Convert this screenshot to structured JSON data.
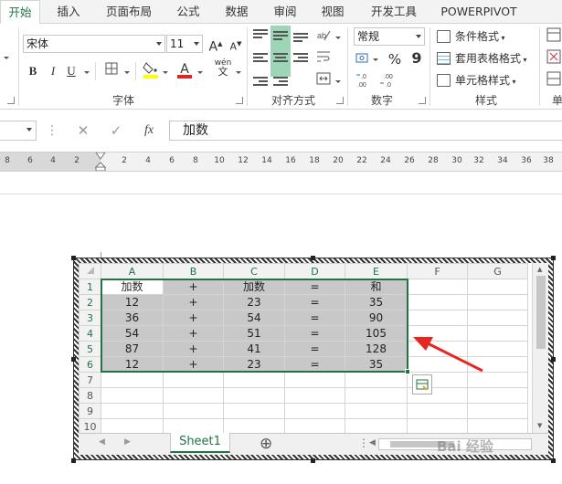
{
  "ribbon_tabs": [
    "开始",
    "插入",
    "页面布局",
    "公式",
    "数据",
    "审阅",
    "视图",
    "开发工具",
    "POWERPIVOT"
  ],
  "font_group": {
    "font_name": "宋体",
    "font_size": "11",
    "grow_label": "A",
    "shrink_label": "A",
    "bold": "B",
    "italic": "I",
    "underline": "U",
    "font_color_label": "A",
    "phonetic": "wén",
    "phonetic_sub": "文",
    "label": "字体"
  },
  "alignment_group": {
    "label": "对齐方式"
  },
  "number_group": {
    "format": "常规",
    "percent": "%",
    "comma": "9",
    "label": "数字"
  },
  "styles_group": {
    "conditional": "条件格式",
    "table_format": "套用表格格式",
    "cell_styles": "单元格样式",
    "label": "样式",
    "cut_label": "单"
  },
  "formula_bar": {
    "cancel": "✕",
    "enter": "✓",
    "fx": "fx",
    "value": "加数"
  },
  "ruler_ticks": [
    "8",
    "6",
    "4",
    "2",
    "2",
    "4",
    "6",
    "8",
    "10",
    "12",
    "14",
    "16",
    "18",
    "20",
    "22",
    "24",
    "26",
    "28",
    "30",
    "32",
    "34",
    "36",
    "38"
  ],
  "sheet": {
    "columns": [
      "A",
      "B",
      "C",
      "D",
      "E",
      "F",
      "G"
    ],
    "row_numbers": [
      "1",
      "2",
      "3",
      "4",
      "5",
      "6",
      "7",
      "8",
      "9",
      "10"
    ],
    "rows": [
      [
        "加数",
        "+",
        "加数",
        "=",
        "和"
      ],
      [
        "12",
        "+",
        "23",
        "=",
        "35"
      ],
      [
        "36",
        "+",
        "54",
        "=",
        "90"
      ],
      [
        "54",
        "+",
        "51",
        "=",
        "105"
      ],
      [
        "87",
        "+",
        "41",
        "=",
        "128"
      ],
      [
        "12",
        "+",
        "23",
        "=",
        "35"
      ]
    ],
    "tab_name": "Sheet1",
    "add_sheet": "⊕",
    "scroll_dots": "⋮"
  },
  "watermark": "Bai 经验",
  "colors": {
    "accent": "#217346",
    "selection_fill": "#c8c8c8",
    "arrow": "#e8251f"
  }
}
